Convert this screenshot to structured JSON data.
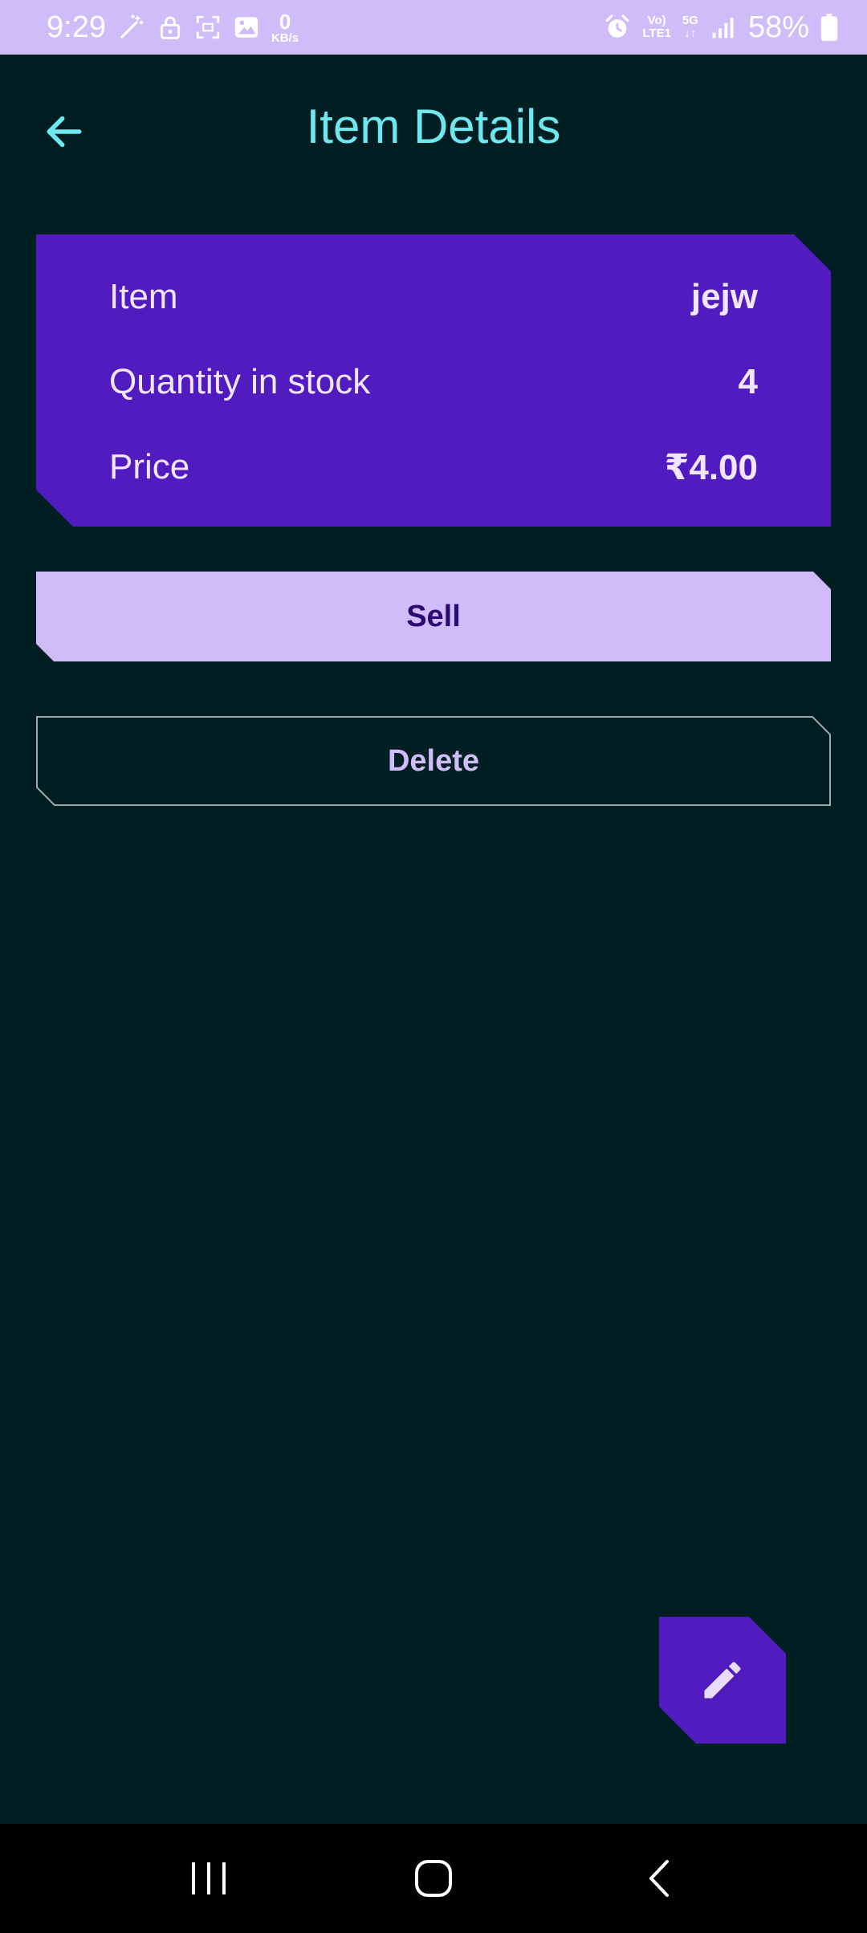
{
  "status_bar": {
    "time": "9:29",
    "net_speed_value": "0",
    "net_speed_unit": "KB/s",
    "volte_top": "Vo)",
    "volte_bottom": "LTE1",
    "network_type": "5G",
    "battery": "58%"
  },
  "app_bar": {
    "title": "Item Details",
    "back_icon": "arrow-back-icon"
  },
  "details": {
    "item_label": "Item",
    "item_value": "jejw",
    "quantity_label": "Quantity in stock",
    "quantity_value": "4",
    "price_label": "Price",
    "price_value": "₹4.00"
  },
  "actions": {
    "sell_label": "Sell",
    "delete_label": "Delete"
  },
  "fab": {
    "icon": "edit-pencil-icon"
  },
  "colors": {
    "background": "#011f23",
    "status_bar": "#cfbcf9",
    "title": "#6ee7ef",
    "card": "#511bbf",
    "sell_button": "#cfbcf9",
    "delete_outline": "#9ea8ad"
  }
}
